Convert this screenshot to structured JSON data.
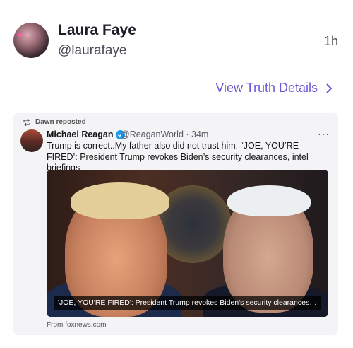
{
  "post": {
    "author_name": "Laura Faye",
    "author_handle": "@laurafaye",
    "time": "1h",
    "details_link": "View Truth Details"
  },
  "repost": {
    "reposted_by": "Dawn reposted",
    "author_name": "Michael Reagan",
    "author_handle_time": "@ReaganWorld · 34m",
    "text": "Trump is correct..My father also did not trust him. “JOE, YOU’RE FIRED’: President Trump revokes Biden’s security clearances, intel briefings",
    "image_caption": "'JOE, YOU'RE FIRED': President Trump revokes Biden's security clearances, int...",
    "source": "From foxnews.com",
    "more": "···"
  },
  "colors": {
    "link": "#6a5ad6",
    "verified": "#1d9bf0"
  }
}
